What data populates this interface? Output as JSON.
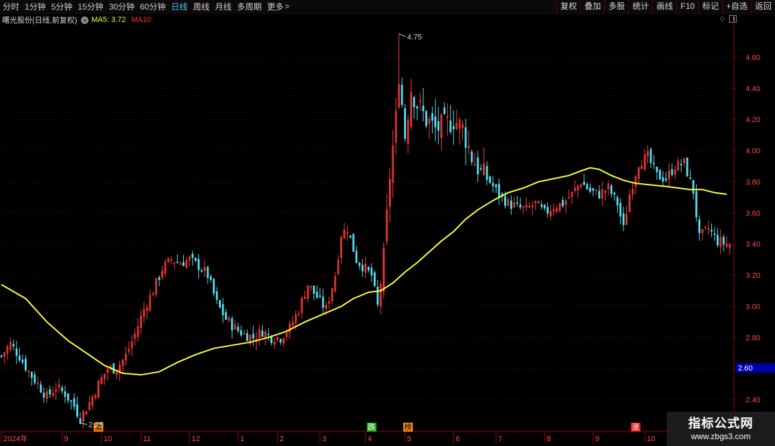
{
  "toolbar": {
    "periods": [
      "分时",
      "1分钟",
      "5分钟",
      "15分钟",
      "30分钟",
      "60分钟",
      "日线",
      "周线",
      "月线",
      "多周期",
      "更多"
    ],
    "active_period": "日线",
    "more_arrow": ">",
    "actions": [
      "复权",
      "叠加",
      "多股",
      "统计",
      "画线",
      "F10",
      "标记",
      "+自选",
      "返回"
    ]
  },
  "infobar": {
    "stock_title": "曙光股份(日线,前复权)",
    "ma_toggle": "v",
    "ma5_label": "MA5: 3.72",
    "ma10_label": "MA10:"
  },
  "colors": {
    "up": "#ff3c3c",
    "down": "#54e1f4",
    "ma_line": "#ffff33",
    "grid": "#7a0000",
    "axis_text": "#ff4a4a",
    "price_tag_bg": "#0000a8"
  },
  "chart_data": {
    "type": "candlestick",
    "y_range": [
      2.2,
      4.8
    ],
    "y_ticks": [
      2.4,
      2.6,
      2.8,
      3.0,
      3.2,
      3.4,
      3.6,
      3.8,
      4.0,
      4.2,
      4.4,
      4.6
    ],
    "y_tick_labels": [
      "2.40",
      "2.60",
      "2.80",
      "3.00",
      "3.20",
      "3.40",
      "3.60",
      "3.80",
      "4.00",
      "4.20",
      "4.40",
      "4.60"
    ],
    "current_price_label": "2.60",
    "current_price": 2.6,
    "high_marker": {
      "label": "4.75",
      "value": 4.75,
      "date_index": 131
    },
    "low_marker": {
      "label": "2.25",
      "value": 2.25,
      "date_index": 26
    },
    "x_labels": [
      {
        "label": "2024年",
        "index": 0
      },
      {
        "label": "9",
        "index": 20
      },
      {
        "label": "10",
        "index": 33
      },
      {
        "label": "11",
        "index": 46
      },
      {
        "label": "12",
        "index": 62
      },
      {
        "label": "1",
        "index": 78
      },
      {
        "label": "2",
        "index": 91
      },
      {
        "label": "3",
        "index": 105
      },
      {
        "label": "4",
        "index": 120
      },
      {
        "label": "5",
        "index": 133
      },
      {
        "label": "6",
        "index": 149
      },
      {
        "label": "7",
        "index": 163
      },
      {
        "label": "8",
        "index": 179
      },
      {
        "label": "9",
        "index": 195
      },
      {
        "label": "10",
        "index": 212
      }
    ],
    "event_badges": [
      {
        "label": "激",
        "index": 32,
        "color": "#ff8c1a",
        "text_color": "#000000"
      },
      {
        "label": "跌",
        "index": 122,
        "color": "#22aa22",
        "text_color": "#ffffff"
      },
      {
        "label": "榜",
        "index": 134,
        "color": "#ff8c1a",
        "text_color": "#000000"
      },
      {
        "label": "涨",
        "index": 209,
        "color": "#dd2222",
        "text_color": "#ffffff"
      }
    ],
    "close_points": [
      [
        0,
        2.68
      ],
      [
        3,
        2.76
      ],
      [
        6,
        2.68
      ],
      [
        9,
        2.58
      ],
      [
        12,
        2.5
      ],
      [
        15,
        2.42
      ],
      [
        18,
        2.48
      ],
      [
        21,
        2.44
      ],
      [
        24,
        2.36
      ],
      [
        26,
        2.28
      ],
      [
        29,
        2.38
      ],
      [
        32,
        2.5
      ],
      [
        35,
        2.6
      ],
      [
        38,
        2.6
      ],
      [
        41,
        2.68
      ],
      [
        44,
        2.82
      ],
      [
        47,
        2.98
      ],
      [
        50,
        3.1
      ],
      [
        53,
        3.24
      ],
      [
        56,
        3.3
      ],
      [
        59,
        3.28
      ],
      [
        62,
        3.3
      ],
      [
        65,
        3.26
      ],
      [
        68,
        3.2
      ],
      [
        71,
        3.02
      ],
      [
        74,
        2.92
      ],
      [
        77,
        2.86
      ],
      [
        80,
        2.82
      ],
      [
        83,
        2.8
      ],
      [
        86,
        2.84
      ],
      [
        89,
        2.8
      ],
      [
        92,
        2.8
      ],
      [
        95,
        2.86
      ],
      [
        98,
        2.98
      ],
      [
        101,
        3.14
      ],
      [
        104,
        3.06
      ],
      [
        107,
        2.98
      ],
      [
        110,
        3.2
      ],
      [
        112,
        3.46
      ],
      [
        114,
        3.5
      ],
      [
        117,
        3.3
      ],
      [
        120,
        3.24
      ],
      [
        122,
        3.2
      ],
      [
        124,
        3.0
      ],
      [
        126,
        3.3
      ],
      [
        128,
        3.84
      ],
      [
        130,
        4.2
      ],
      [
        131,
        4.5
      ],
      [
        133,
        4.1
      ],
      [
        135,
        4.4
      ],
      [
        137,
        4.3
      ],
      [
        140,
        4.2
      ],
      [
        143,
        4.14
      ],
      [
        146,
        4.16
      ],
      [
        149,
        4.2
      ],
      [
        152,
        4.14
      ],
      [
        155,
        3.96
      ],
      [
        158,
        3.86
      ],
      [
        161,
        3.8
      ],
      [
        164,
        3.72
      ],
      [
        167,
        3.66
      ],
      [
        170,
        3.64
      ],
      [
        173,
        3.62
      ],
      [
        176,
        3.66
      ],
      [
        179,
        3.6
      ],
      [
        182,
        3.64
      ],
      [
        185,
        3.66
      ],
      [
        188,
        3.72
      ],
      [
        191,
        3.8
      ],
      [
        194,
        3.74
      ],
      [
        197,
        3.72
      ],
      [
        200,
        3.76
      ],
      [
        203,
        3.66
      ],
      [
        205,
        3.5
      ],
      [
        207,
        3.72
      ],
      [
        210,
        3.92
      ],
      [
        213,
        3.96
      ],
      [
        216,
        3.84
      ],
      [
        219,
        3.82
      ],
      [
        222,
        3.9
      ],
      [
        225,
        3.92
      ],
      [
        228,
        3.74
      ],
      [
        230,
        3.44
      ],
      [
        233,
        3.5
      ],
      [
        236,
        3.42
      ],
      [
        239,
        3.4
      ]
    ],
    "ma_line": [
      [
        0,
        3.14
      ],
      [
        8,
        3.05
      ],
      [
        15,
        2.9
      ],
      [
        22,
        2.78
      ],
      [
        28,
        2.7
      ],
      [
        34,
        2.62
      ],
      [
        40,
        2.57
      ],
      [
        46,
        2.56
      ],
      [
        52,
        2.58
      ],
      [
        58,
        2.64
      ],
      [
        64,
        2.69
      ],
      [
        70,
        2.73
      ],
      [
        76,
        2.75
      ],
      [
        82,
        2.77
      ],
      [
        88,
        2.8
      ],
      [
        94,
        2.84
      ],
      [
        100,
        2.9
      ],
      [
        106,
        2.95
      ],
      [
        112,
        3.0
      ],
      [
        116,
        3.05
      ],
      [
        121,
        3.09
      ],
      [
        125,
        3.1
      ],
      [
        129,
        3.15
      ],
      [
        133,
        3.22
      ],
      [
        137,
        3.28
      ],
      [
        141,
        3.35
      ],
      [
        145,
        3.42
      ],
      [
        149,
        3.48
      ],
      [
        153,
        3.56
      ],
      [
        157,
        3.62
      ],
      [
        162,
        3.68
      ],
      [
        167,
        3.73
      ],
      [
        172,
        3.76
      ],
      [
        177,
        3.8
      ],
      [
        182,
        3.82
      ],
      [
        187,
        3.84
      ],
      [
        191,
        3.87
      ],
      [
        194,
        3.89
      ],
      [
        197,
        3.88
      ],
      [
        201,
        3.84
      ],
      [
        205,
        3.81
      ],
      [
        209,
        3.79
      ],
      [
        214,
        3.78
      ],
      [
        219,
        3.77
      ],
      [
        223,
        3.76
      ],
      [
        227,
        3.75
      ],
      [
        231,
        3.75
      ],
      [
        235,
        3.73
      ],
      [
        239,
        3.72
      ]
    ]
  },
  "watermark": {
    "title": "指标公式网",
    "url": "www.zbgs3.com"
  }
}
